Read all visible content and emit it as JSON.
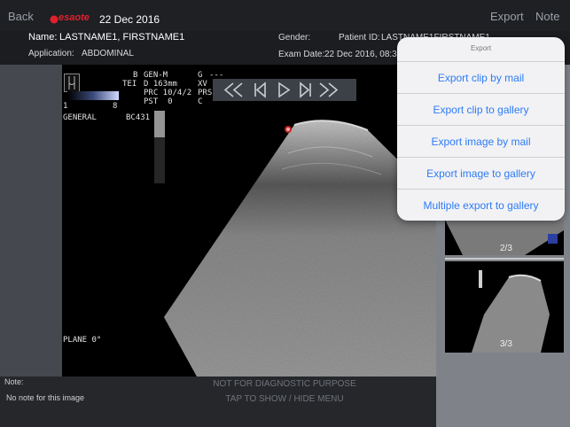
{
  "topbar": {
    "back_label": "Back",
    "brand": "esaote",
    "date": "22 Dec 2016",
    "export_label": "Export",
    "note_label": "Note"
  },
  "patient": {
    "name_label": "Name:",
    "name_value": "LASTNAME1, FIRSTNAME1",
    "application_label": "Application:",
    "application_value": "ABDOMINAL",
    "gender_label": "Gender:",
    "patient_id_label": "Patient ID:",
    "patient_id_value": "LASTNAME1FIRSTNAME1",
    "exam_date_label": "Exam Date:",
    "exam_date_value": "22 Dec 2016, 08:36"
  },
  "image_header": {
    "mode": "B",
    "probe_line1": "GEN-M",
    "tei_label": "TEI",
    "depth": "D 163mm",
    "prc": "PRC 10/4/2",
    "pst": "PST  0",
    "g_label": "G",
    "g_value": "---",
    "xv": "XV",
    "prs": "PRS",
    "c_label": "C",
    "scale_min": "1",
    "scale_max": "8",
    "preset": "GENERAL",
    "probe": "BC431",
    "plane": "PLANE 0°"
  },
  "export_menu": {
    "title": "Export",
    "items": [
      "Export clip by mail",
      "Export clip to gallery",
      "Export image by mail",
      "Export image to gallery",
      "Multiple export to gallery"
    ]
  },
  "thumbnails": [
    {
      "label": "2/3"
    },
    {
      "label": "3/3"
    }
  ],
  "note": {
    "label": "Note:",
    "value": "No note for this image"
  },
  "overlay": {
    "disclaimer": "NOT FOR DIAGNOSTIC PURPOSE",
    "hint": "TAP TO SHOW / HIDE MENU"
  },
  "colors": {
    "accent": "#2d7bf6",
    "brand": "#e0202a"
  }
}
